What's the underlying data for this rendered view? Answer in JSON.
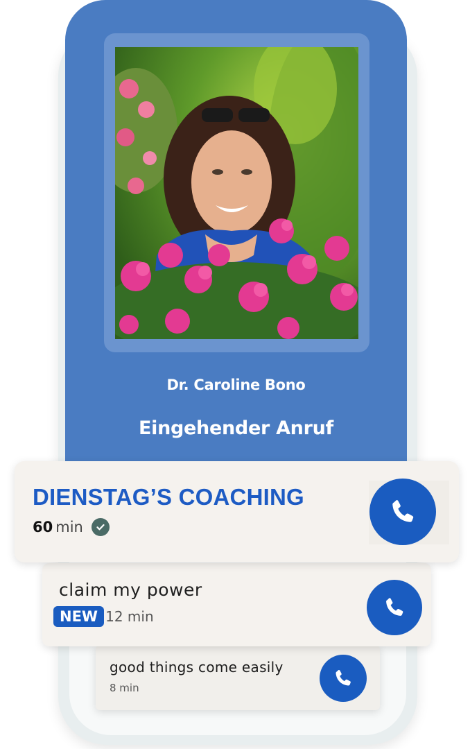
{
  "caller": {
    "name": "Dr. Caroline Bono",
    "status": "Eingehender Anruf"
  },
  "sessions": [
    {
      "title": "DIENSTAG’S COACHING",
      "duration": "60",
      "unit": "min",
      "completed": true
    },
    {
      "title": "claim my power",
      "badge": "NEW",
      "duration": "12 min"
    },
    {
      "title": "good things come easily",
      "duration": "8 min"
    }
  ],
  "colors": {
    "screen": "#4a7cc2",
    "accent": "#1a5cc0",
    "card": "#f5f2ee",
    "check": "#4a6b66"
  },
  "icons": {
    "call": "phone-icon",
    "completed": "check-circle-icon"
  }
}
